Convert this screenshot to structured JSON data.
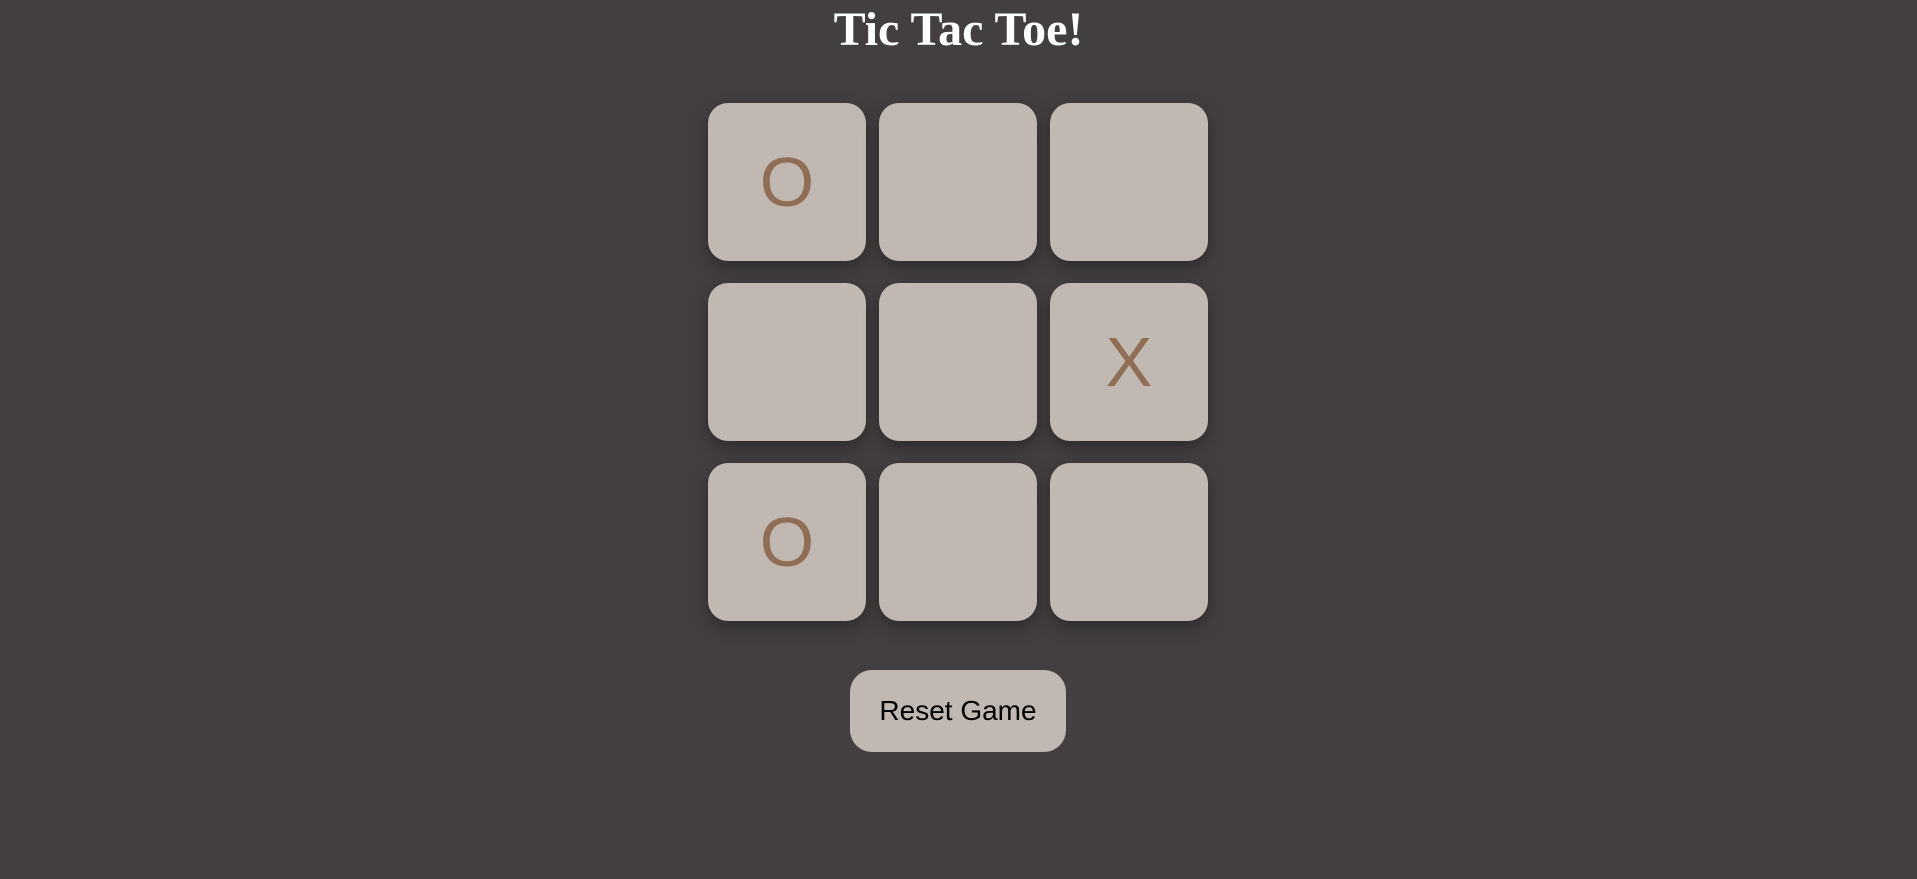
{
  "header": {
    "title": "Tic Tac Toe!"
  },
  "board": {
    "cells": [
      "O",
      "",
      "",
      "",
      "",
      "X",
      "O",
      "",
      ""
    ]
  },
  "controls": {
    "reset_label": "Reset Game"
  },
  "colors": {
    "background": "#433f40",
    "tile": "#c2b8b2",
    "mark": "#8f6e55",
    "title": "#ffffff"
  }
}
